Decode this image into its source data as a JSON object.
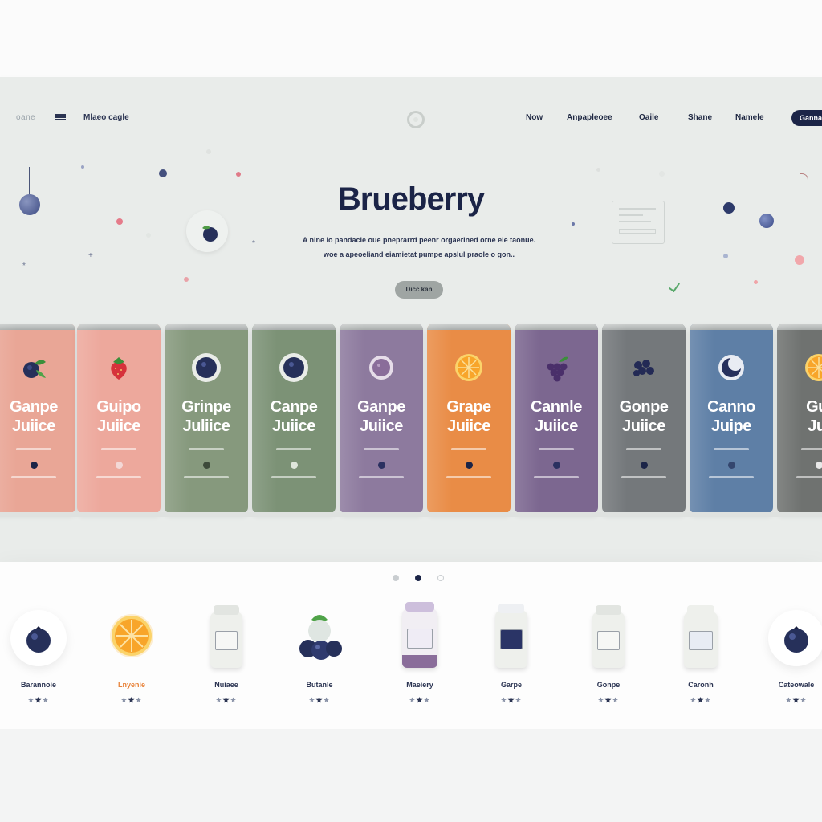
{
  "nav": {
    "logo": "oane",
    "left_link": "Mlaeo cagle",
    "items": [
      "Now",
      "Anpapleoee",
      "Oaile",
      "Shane",
      "Namele"
    ],
    "cta": "Ganna"
  },
  "hero": {
    "title": "Brueberry",
    "description_line1": "A nine lo pandacie oue pneprarrd peenr orgaerined orne ele taonue.",
    "description_line2": "woe a apeoeliand eiamietat pumpe apslul praole o gon..",
    "button": "Dicc kan"
  },
  "cans": [
    {
      "name_line1": "Ganpe",
      "name_line2": "Juiice",
      "color": "#e9a696",
      "fruit": "blueberry-leaf",
      "dot_color": "#1b2447"
    },
    {
      "name_line1": "Guipo",
      "name_line2": "Juiice",
      "color": "#eda89c",
      "fruit": "strawberry",
      "dot_color": "#f3d8d6"
    },
    {
      "name_line1": "Grinpe",
      "name_line2": "Juliice",
      "color": "#86997d",
      "fruit": "blueberry-plate",
      "dot_color": "#3d4a3a"
    },
    {
      "name_line1": "Canpe",
      "name_line2": "Juiice",
      "color": "#7c9276",
      "fruit": "blueberry-plate",
      "dot_color": "#dfe6db"
    },
    {
      "name_line1": "Ganpe",
      "name_line2": "Juiice",
      "color": "#8d7a9e",
      "fruit": "plum",
      "dot_color": "#2b3060"
    },
    {
      "name_line1": "Grape",
      "name_line2": "Juiice",
      "color": "#e98c46",
      "fruit": "orange-slice",
      "dot_color": "#1b2447"
    },
    {
      "name_line1": "Cannle",
      "name_line2": "Juiice",
      "color": "#7c6790",
      "fruit": "grapes",
      "dot_color": "#2b3060"
    },
    {
      "name_line1": "Gonpe",
      "name_line2": "Juiice",
      "color": "#74787b",
      "fruit": "blackberries",
      "dot_color": "#1b2447"
    },
    {
      "name_line1": "Canno",
      "name_line2": "Juipe",
      "color": "#5e7fa6",
      "fruit": "moon-fruit",
      "dot_color": "#34466e"
    },
    {
      "name_line1": "Gui",
      "name_line2": "Jui",
      "color": "#6f7270",
      "fruit": "orange-slice",
      "dot_color": "#e8e8e8"
    }
  ],
  "pager": [
    "dot-1",
    "dot-2",
    "dot-3"
  ],
  "products": [
    {
      "label": "Barannoie",
      "pic": "blueberry-circle",
      "label_color": "#2b3452"
    },
    {
      "label": "Lnyenie",
      "pic": "orange",
      "label_color": "#e8833a"
    },
    {
      "label": "Nuiaee",
      "pic": "jar-plain",
      "label_color": "#2b3452"
    },
    {
      "label": "Butanle",
      "pic": "blueberries",
      "label_color": "#2b3452"
    },
    {
      "label": "Maeiery",
      "pic": "jar-purple",
      "label_color": "#2b3452"
    },
    {
      "label": "Garpe",
      "pic": "jar-navy",
      "label_color": "#2b3452"
    },
    {
      "label": "Gonpe",
      "pic": "jar-plain",
      "label_color": "#2b3452"
    },
    {
      "label": "Caronh",
      "pic": "jar-label",
      "label_color": "#2b3452"
    },
    {
      "label": "Cateowale",
      "pic": "blueberry-circle",
      "label_color": "#2b3452"
    }
  ],
  "stars": {
    "dim": "★",
    "lit": "★"
  },
  "colors": {
    "navy": "#1b2447",
    "hero_bg": "#e9ecea",
    "accent_orange": "#e8833a"
  }
}
